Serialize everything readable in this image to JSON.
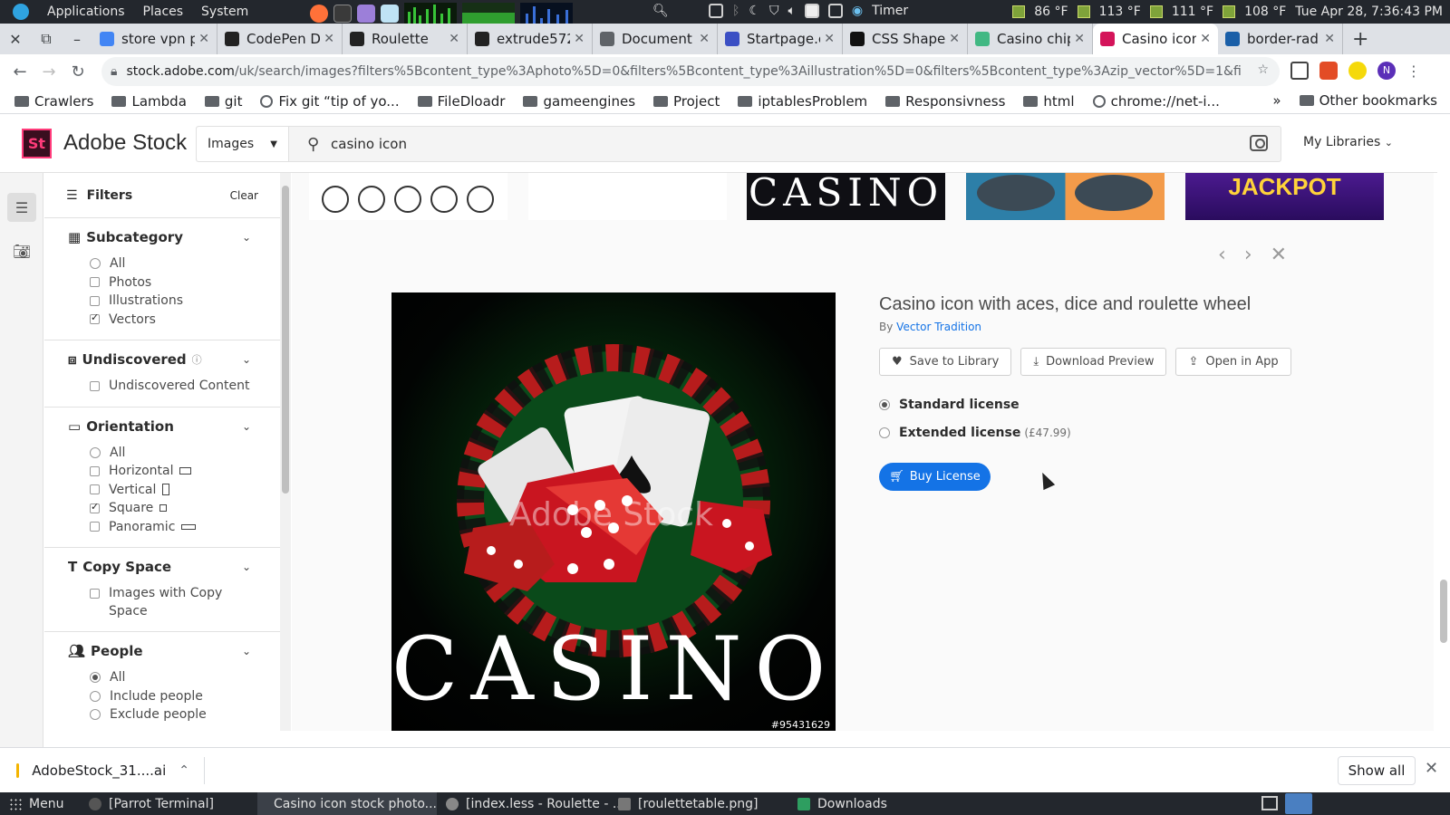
{
  "system_panel": {
    "menus": [
      "Applications",
      "Places",
      "System"
    ],
    "timer_label": "Timer",
    "temps": [
      "86 °F",
      "113 °F",
      "111 °F",
      "108 °F"
    ],
    "clock": "Tue Apr 28,  7:36:43 PM"
  },
  "tabs": [
    {
      "title": "store vpn p",
      "favicon": "google-icon",
      "color": "#4285f4"
    },
    {
      "title": "CodePen D",
      "favicon": "codepen-icon",
      "color": "#222222"
    },
    {
      "title": "Roulette",
      "favicon": "codepen-icon",
      "color": "#222222"
    },
    {
      "title": "extrude572",
      "favicon": "github-icon",
      "color": "#222222"
    },
    {
      "title": "Document",
      "favicon": "globe-icon",
      "color": "#5f6368"
    },
    {
      "title": "Startpage.c",
      "favicon": "startpage-icon",
      "color": "#3b4fc4"
    },
    {
      "title": "CSS Shape",
      "favicon": "css-tricks-icon",
      "color": "#111111"
    },
    {
      "title": "Casino chip",
      "favicon": "vue-icon",
      "color": "#41b883"
    },
    {
      "title": "Casino icon",
      "favicon": "adobe-stock-icon",
      "color": "#d4145a",
      "active": true
    },
    {
      "title": "border-rad",
      "favicon": "mdn-icon",
      "color": "#1a5fa8"
    }
  ],
  "omnibox": {
    "domain": "stock.adobe.com",
    "path": "/uk/search/images?filters%5Bcontent_type%3Aphoto%5D=0&filters%5Bcontent_type%3Aillustration%5D=0&filters%5Bcontent_type%3Azip_vector%5D=1&filters%5Bconte..."
  },
  "bookmarks": [
    {
      "label": "Crawlers",
      "icon": "folder-icon"
    },
    {
      "label": "Lambda",
      "icon": "folder-icon"
    },
    {
      "label": "git",
      "icon": "folder-icon"
    },
    {
      "label": "Fix git “tip of yo...",
      "icon": "page-icon"
    },
    {
      "label": "FileDloadr",
      "icon": "folder-icon"
    },
    {
      "label": "gameengines",
      "icon": "folder-icon"
    },
    {
      "label": "Project",
      "icon": "folder-icon"
    },
    {
      "label": "iptablesProblem",
      "icon": "folder-icon"
    },
    {
      "label": "Responsivness",
      "icon": "folder-icon"
    },
    {
      "label": "html",
      "icon": "folder-icon"
    },
    {
      "label": "chrome://net-i...",
      "icon": "globe-icon"
    }
  ],
  "bookmarks_more": "»",
  "bookmarks_other": "Other bookmarks",
  "adobe": {
    "logo": "St",
    "brand": "Adobe Stock",
    "search_type": "Images",
    "search_query": "casino icon",
    "my_libraries": "My Libraries"
  },
  "filters": {
    "title": "Filters",
    "clear": "Clear",
    "sections": {
      "subcategory": {
        "title": "Subcategory",
        "options": [
          "All",
          "Photos",
          "Illustrations",
          "Vectors"
        ]
      },
      "undiscovered": {
        "title": "Undiscovered",
        "options": [
          "Undiscovered Content"
        ]
      },
      "orientation": {
        "title": "Orientation",
        "options": [
          "All",
          "Horizontal",
          "Vertical",
          "Square",
          "Panoramic"
        ]
      },
      "copy_space": {
        "title": "Copy Space",
        "options": [
          "Images with Copy Space"
        ]
      },
      "people": {
        "title": "People",
        "options": [
          "All",
          "Include people",
          "Exclude people"
        ]
      }
    }
  },
  "detail": {
    "title": "Casino icon with aces, dice and roulette wheel",
    "by_prefix": "By",
    "author": "Vector Tradition",
    "actions": [
      "Save to Library",
      "Download Preview",
      "Open in App"
    ],
    "standard_license": "Standard license",
    "extended_license": "Extended license",
    "extended_price": "(£47.99)",
    "buy": "Buy License"
  },
  "image": {
    "text": "CASINO",
    "watermark": "Adobe Stock",
    "id": "#95431629"
  },
  "thumb_strip": {
    "casino_text": "CASINO",
    "jackpot_text": "JACKPOT"
  },
  "downloads": {
    "file": "AdobeStock_31....ai",
    "show_all": "Show all"
  },
  "taskbar": {
    "menu": "Menu",
    "items": [
      "[Parrot Terminal]",
      "Casino icon stock photo...",
      "[index.less - Roulette - ...",
      "[roulettetable.png]",
      "Downloads"
    ]
  }
}
